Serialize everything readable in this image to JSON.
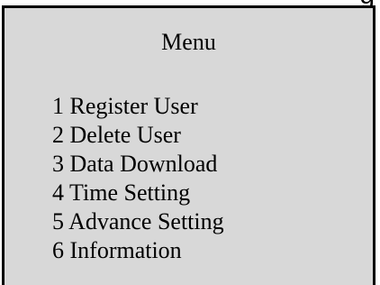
{
  "top_cut_text": "g",
  "menu": {
    "title": "Menu",
    "items": [
      {
        "label": "1 Register User"
      },
      {
        "label": "2 Delete User"
      },
      {
        "label": "3 Data Download"
      },
      {
        "label": "4 Time Setting"
      },
      {
        "label": "5 Advance Setting"
      },
      {
        "label": "6 Information"
      }
    ]
  },
  "colors": {
    "panel_background": "#d8d8d8",
    "border": "#000000",
    "text": "#000000"
  }
}
